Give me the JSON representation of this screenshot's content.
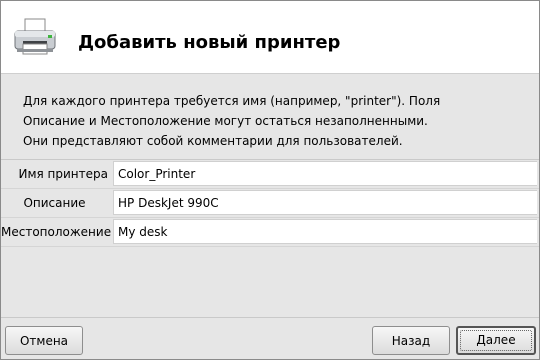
{
  "dialog": {
    "title": "Добавить новый принтер",
    "icon": "printer-icon"
  },
  "description": {
    "line1": "Для каждого принтера требуется имя (например, \"printer\"). Поля",
    "line2": "Описание и Местоположение могут остаться незаполненными.",
    "line3": "Они представляют собой комментарии для пользователей."
  },
  "form": {
    "name_label": "Имя принтера",
    "name_value": "Color_Printer",
    "description_label": "Описание",
    "description_value": "HP DeskJet 990C",
    "location_label": "Местоположение",
    "location_value": "My desk"
  },
  "buttons": {
    "cancel": "Отмена",
    "back": "Назад",
    "next": "Далее"
  }
}
